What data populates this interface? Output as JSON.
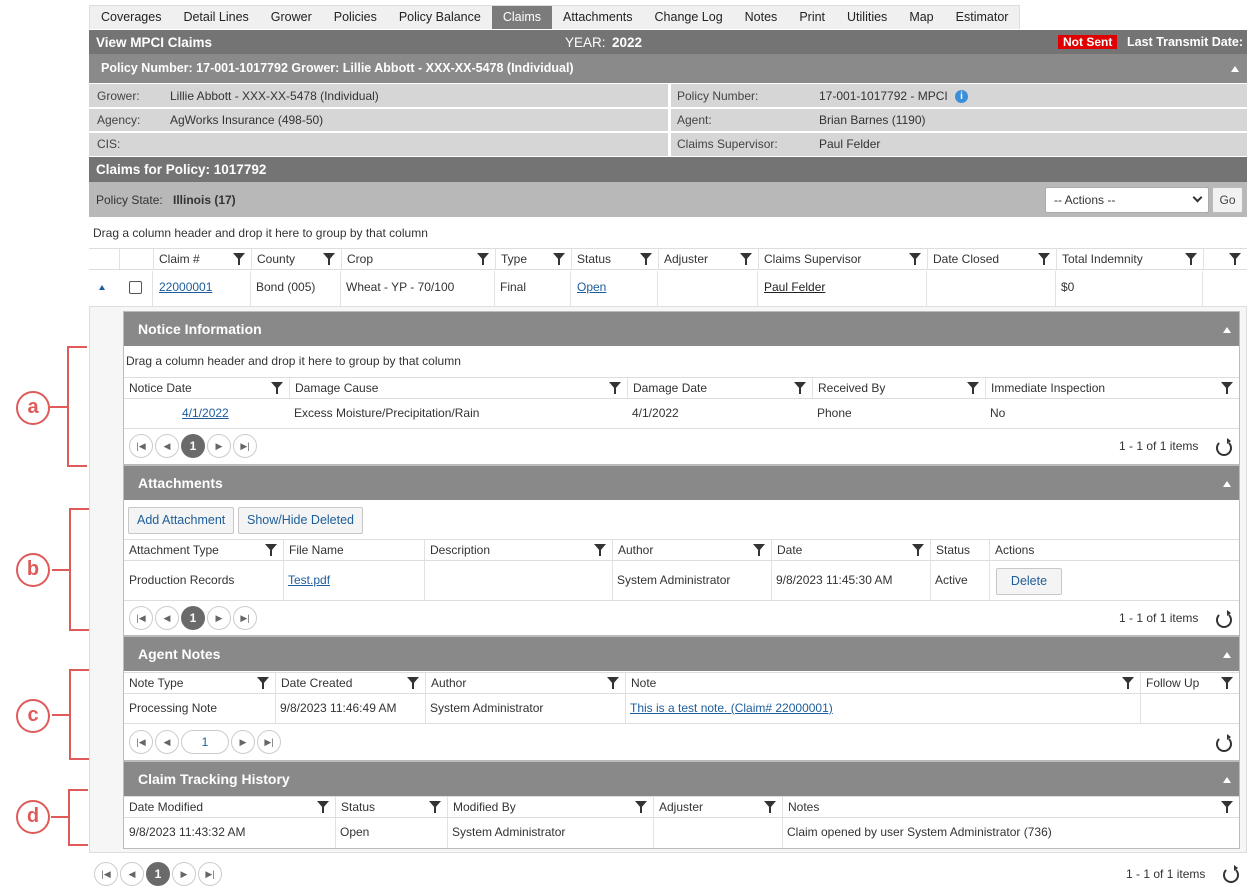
{
  "tabs": [
    "Coverages",
    "Detail Lines",
    "Grower",
    "Policies",
    "Policy Balance",
    "Claims",
    "Attachments",
    "Change Log",
    "Notes",
    "Print",
    "Utilities",
    "Map",
    "Estimator"
  ],
  "header": {
    "title": "View MPCI Claims",
    "year_label": "YEAR:",
    "year": "2022",
    "status_badge": "Not Sent",
    "transmit_label": "Last Transmit Date:"
  },
  "policy_bar": "Policy Number: 17-001-1017792 Grower: Lillie Abbott - XXX-XX-5478 (Individual)",
  "info": {
    "grower_label": "Grower:",
    "grower": "Lillie Abbott - XXX-XX-5478 (Individual)",
    "agency_label": "Agency:",
    "agency": "AgWorks Insurance (498-50)",
    "cis_label": "CIS:",
    "policy_number_label": "Policy Number:",
    "policy_number": "17-001-1017792 - MPCI",
    "agent_label": "Agent:",
    "agent": "Brian Barnes (1190)",
    "supervisor_label": "Claims Supervisor:",
    "supervisor": "Paul Felder"
  },
  "claims_title": "Claims for Policy: 1017792",
  "policy_state_label": "Policy State:",
  "policy_state": "Illinois (17)",
  "actions_select": "-- Actions --",
  "go_label": "Go",
  "group_hint": "Drag a column header and drop it here to group by that column",
  "claims_grid": {
    "headers": [
      "Claim #",
      "County",
      "Crop",
      "Type",
      "Status",
      "Adjuster",
      "Claims Supervisor",
      "Date Closed",
      "Total Indemnity"
    ],
    "row": {
      "claim": "22000001",
      "county": "Bond (005)",
      "crop": "Wheat - YP - 70/100",
      "type": "Final",
      "status": "Open",
      "adjuster": "",
      "supervisor": "Paul Felder",
      "date_closed": "",
      "indemnity": "$0"
    },
    "pager_info": "1 - 1 of 1 items"
  },
  "notice": {
    "title": "Notice Information",
    "group_hint": "Drag a column header and drop it here to group by that column",
    "headers": [
      "Notice Date",
      "Damage Cause",
      "Damage Date",
      "Received By",
      "Immediate Inspection"
    ],
    "row": [
      "4/1/2022",
      "Excess Moisture/Precipitation/Rain",
      "4/1/2022",
      "Phone",
      "No"
    ],
    "pager_info": "1 - 1 of 1 items"
  },
  "attachments": {
    "title": "Attachments",
    "add_label": "Add Attachment",
    "toggle_label": "Show/Hide Deleted",
    "headers": [
      "Attachment Type",
      "File Name",
      "Description",
      "Author",
      "Date",
      "Status",
      "Actions"
    ],
    "row": [
      "Production Records",
      "Test.pdf",
      "",
      "System Administrator",
      "9/8/2023 11:45:30 AM",
      "Active"
    ],
    "delete_label": "Delete",
    "pager_info": "1 - 1 of 1 items"
  },
  "agent_notes": {
    "title": "Agent Notes",
    "headers": [
      "Note Type",
      "Date Created",
      "Author",
      "Note",
      "Follow Up"
    ],
    "row": [
      "Processing Note",
      "9/8/2023 11:46:49 AM",
      "System Administrator",
      "This is a test note. (Claim# 22000001)",
      ""
    ]
  },
  "tracking": {
    "title": "Claim Tracking History",
    "headers": [
      "Date Modified",
      "Status",
      "Modified By",
      "Adjuster",
      "Notes"
    ],
    "row": [
      "9/8/2023 11:43:32 AM",
      "Open",
      "System Administrator",
      "",
      "Claim opened by user System Administrator (736)"
    ]
  },
  "page_number": "1",
  "callouts": [
    "a",
    "b",
    "c",
    "d"
  ],
  "colors": {
    "header": "#747474",
    "badge": "#e00000",
    "callout": "#e05a5a",
    "link": "#1d5d9b"
  }
}
